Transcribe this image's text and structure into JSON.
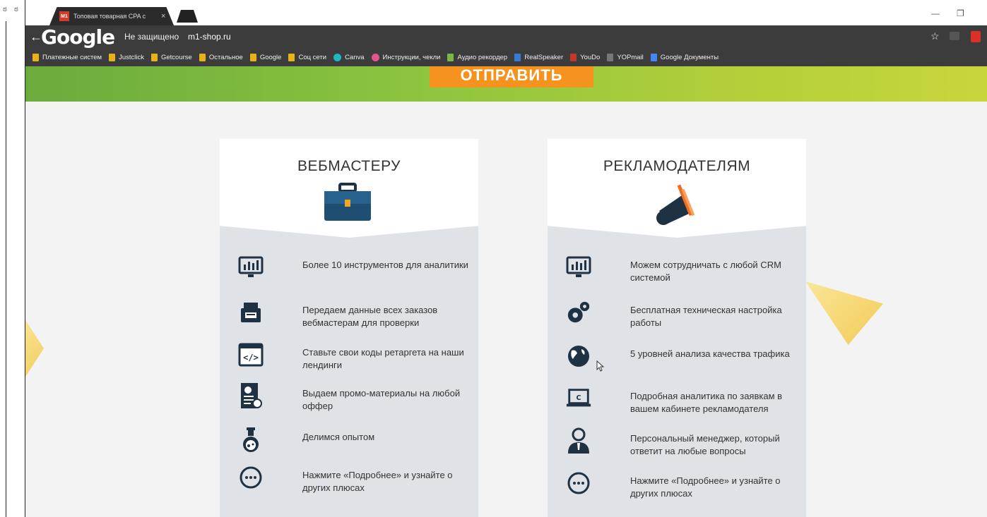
{
  "browser": {
    "tab_title": "Топовая товарная CPA с",
    "tab_favicon": "M1",
    "tab_close": "×",
    "google_logo": "Google",
    "security_label": "Не защищено",
    "url": "m1-shop.ru",
    "bookmarks": [
      {
        "label": "Платежные систем",
        "icon": "folder"
      },
      {
        "label": "Justclick",
        "icon": "folder"
      },
      {
        "label": "Getcourse",
        "icon": "folder"
      },
      {
        "label": "Остальное",
        "icon": "folder"
      },
      {
        "label": "Google",
        "icon": "folder"
      },
      {
        "label": "Соц сети",
        "icon": "folder"
      },
      {
        "label": "Canva",
        "icon": "canva"
      },
      {
        "label": "Инструкции, чекли",
        "icon": "round-pink"
      },
      {
        "label": "Аудио рекордер",
        "icon": "leaf"
      },
      {
        "label": "RealSpeaker",
        "icon": "square-blue"
      },
      {
        "label": "YouDo",
        "icon": "youdo"
      },
      {
        "label": "YOPmail",
        "icon": "yopmail"
      },
      {
        "label": "Google Документы",
        "icon": "docs"
      }
    ]
  },
  "page": {
    "send_button": "ОТПРАВИТЬ",
    "webmaster": {
      "title": "ВЕБМАСТЕРУ",
      "items": [
        {
          "text": "Более 10 инструментов для аналитики",
          "icon": "monitor-chart-icon"
        },
        {
          "text": "Передаем данные всех заказов вебмастерам для проверки",
          "icon": "printer-icon"
        },
        {
          "text": "Ставьте свои коды ретаргета на наши лендинги",
          "icon": "code-icon"
        },
        {
          "text": "Выдаем промо-материалы на любой оффер",
          "icon": "document-icon"
        },
        {
          "text": "Делимся опытом",
          "icon": "flask-icon"
        },
        {
          "text": "Нажмите «Подробнее» и узнайте о других плюсах",
          "icon": "more-icon"
        }
      ]
    },
    "advertiser": {
      "title": "РЕКЛАМОДАТЕЛЯМ",
      "items": [
        {
          "text": "Можем сотрудничать с любой CRM системой",
          "icon": "monitor-chart-icon"
        },
        {
          "text": "Бесплатная техническая настройка работы",
          "icon": "gears-icon"
        },
        {
          "text": "5 уровней анализа качества трафика",
          "icon": "globe-icon"
        },
        {
          "text": "Подробная аналитика по заявкам в вашем кабинете рекламодателя",
          "icon": "laptop-icon"
        },
        {
          "text": "Персональный менеджер, который ответит на любые вопросы",
          "icon": "manager-icon"
        },
        {
          "text": "Нажмите «Подробнее» и узнайте о других плюсах",
          "icon": "more-icon"
        }
      ]
    }
  },
  "colors": {
    "accent_orange": "#f6921e",
    "green_band": "#8cc43f",
    "card_body": "#dfe2e7",
    "browser_dark": "#3c3c3c"
  }
}
